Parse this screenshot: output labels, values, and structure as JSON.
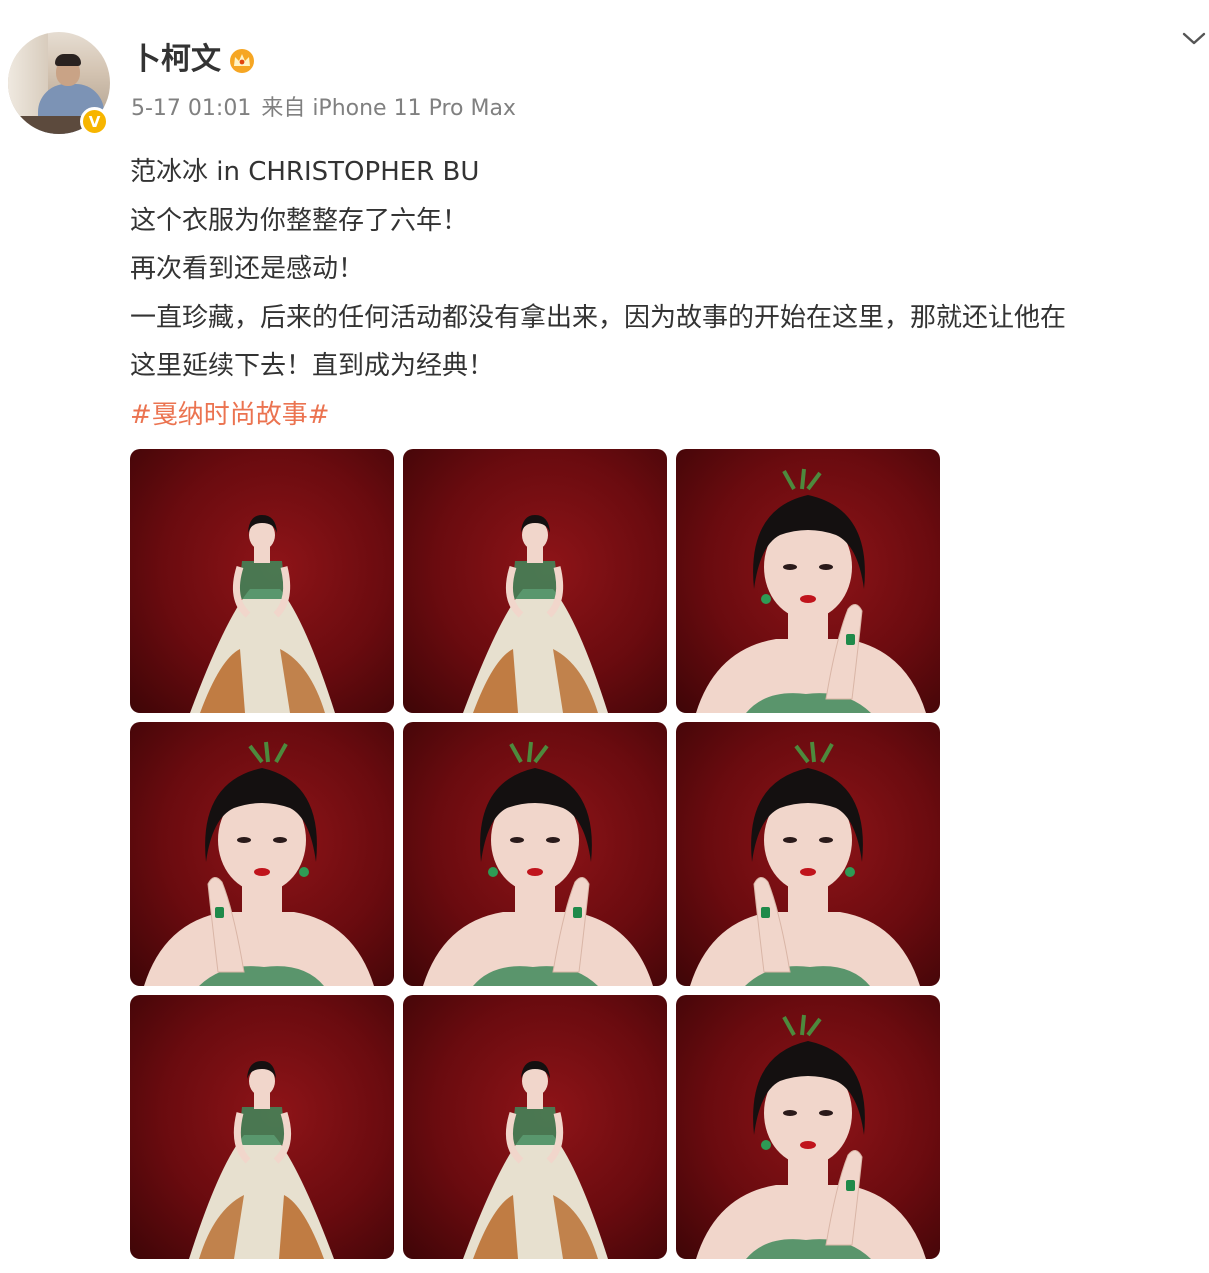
{
  "author": {
    "name": "卜柯文",
    "verified_mark": "V",
    "crown_icon": "crown-icon",
    "avatar_icon": "avatar"
  },
  "meta": {
    "time": "5-17 01:01",
    "source": "来自 iPhone 11 Pro Max"
  },
  "post": {
    "lines": [
      "范冰冰 in CHRISTOPHER BU",
      "这个衣服为你整整存了六年！",
      "再次看到还是感动！",
      "一直珍藏，后来的任何活动都没有拿出来，因为故事的开始在这里，那就还让他在",
      "这里延续下去！直到成为经典！"
    ],
    "hashtag": "#戛纳时尚故事#"
  },
  "photos": [
    {
      "kind": "full-body"
    },
    {
      "kind": "full-body"
    },
    {
      "kind": "portrait"
    },
    {
      "kind": "portrait"
    },
    {
      "kind": "portrait"
    },
    {
      "kind": "portrait"
    },
    {
      "kind": "full-body-side"
    },
    {
      "kind": "full-body"
    },
    {
      "kind": "portrait"
    }
  ],
  "colors": {
    "hashtag": "#eb7350",
    "meta": "#808080",
    "text": "#333333",
    "photo_background": "#7a0c10",
    "badge": "#f7b500"
  }
}
